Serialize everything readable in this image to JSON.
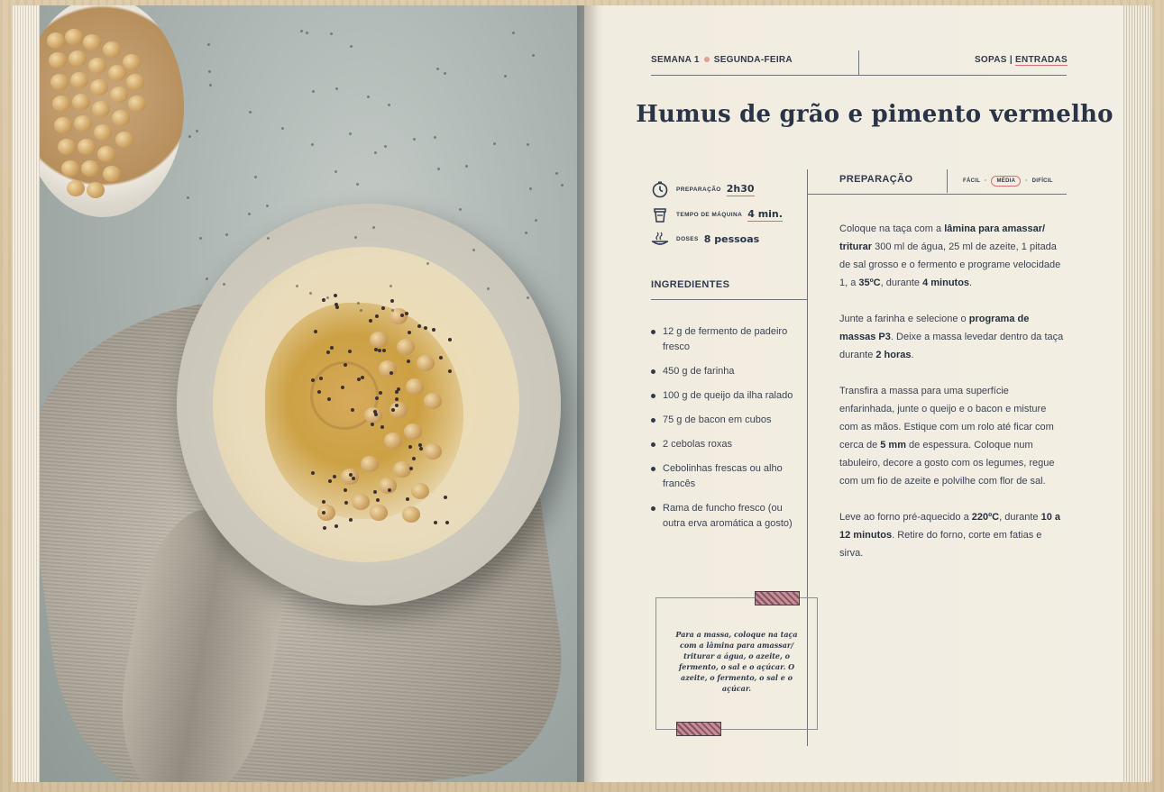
{
  "header": {
    "week": "SEMANA 1",
    "day": "SEGUNDA-FEIRA",
    "category": "SOPAS",
    "separator": "|",
    "subcategory": "ENTRADAS"
  },
  "recipe": {
    "title": "Humus de grão e pimento vermelho",
    "prep_label": "PREPARAÇÃO",
    "prep_value": "2h30",
    "machine_label": "TEMPO DE MÁQUINA",
    "machine_value": "4 min.",
    "doses_label": "DOSES",
    "doses_value": "8 pessoas"
  },
  "ingredients": {
    "title": "INGREDIENTES",
    "items": [
      "12 g de fermento de padeiro fresco",
      "450 g de farinha",
      "100 g de queijo da ilha ralado",
      "75 g de bacon em cubos",
      "2 cebolas roxas",
      "Cebolinhas frescas ou alho francês",
      "Rama de funcho fresco (ou outra erva aromática a gosto)"
    ]
  },
  "preparation": {
    "title": "PREPARAÇÃO",
    "difficulty": {
      "easy": "FÁCIL",
      "medium": "MÉDIA",
      "hard": "DIFÍCIL",
      "selected": "MÉDIA"
    },
    "steps": [
      "Coloque na taça com a <b>lâmina para amassar/ triturar</b> 300 ml de água, 25 ml de azeite, 1 pitada de sal grosso e o fermento e programe velocidade 1, a <b>35ºC</b>, durante <b>4 minutos</b>.",
      "Junte a farinha e selecione o <b>programa de massas P3</b>. Deixe a massa levedar dentro da taça durante <b>2 horas</b>.",
      "Transfira a massa para uma superfície enfarinhada, junte o queijo e o bacon e misture com as mãos. Estique com um rolo até ficar com cerca de <b>5 mm</b> de espessura. Coloque num tabuleiro, decore a gosto com os legumes, regue com um fio de azeite e polvilhe com flor de sal.",
      "Leve ao forno pré-aquecido a <b>220ºC</b>, durante <b>10 a 12 minutos</b>. Retire do forno, corte em fatias e sirva."
    ]
  },
  "note": {
    "text": "Para a massa, coloque na taça com a lâmina para amassar/ triturar a água, o azeite, o fermento, o sal e o açúcar. O azeite, o fermento, o sal e o açúcar."
  },
  "colors": {
    "ink": "#2f3a4c",
    "accent": "#d96e6e",
    "paper": "#f3eee3"
  },
  "icons": [
    "timer-icon",
    "machine-icon",
    "plate-icon"
  ]
}
